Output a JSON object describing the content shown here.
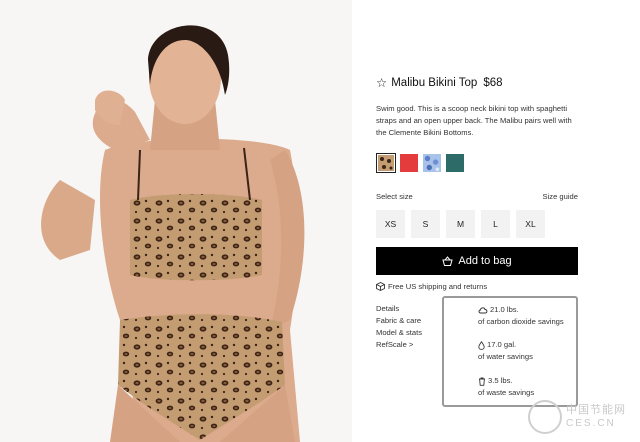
{
  "product": {
    "star_icon": "star-outline-icon",
    "star_glyph": "☆",
    "name": "Malibu Bikini Top",
    "price": "$68",
    "description": "Swim good. This is a scoop neck bikini top with spaghetti straps and an open upper back. The Malibu pairs well with the Clemente Bikini Bottoms."
  },
  "swatches": [
    {
      "name": "leopard",
      "color": "#b99266",
      "selected": true
    },
    {
      "name": "red",
      "color": "#e43c3c",
      "selected": false
    },
    {
      "name": "blue-floral",
      "color": "#7d9fd6",
      "selected": false
    },
    {
      "name": "teal",
      "color": "#2c6b67",
      "selected": false
    }
  ],
  "size": {
    "select_label": "Select size",
    "guide_label": "Size guide",
    "options": [
      "XS",
      "S",
      "M",
      "L",
      "XL"
    ]
  },
  "cart": {
    "add_label": "Add to bag",
    "icon": "bag-icon"
  },
  "shipping": {
    "icon": "box-icon",
    "text": "Free US shipping and returns"
  },
  "details": [
    "Details",
    "Fabric & care",
    "Model & stats",
    "RefScale >"
  ],
  "savings": [
    {
      "icon": "cloud-icon",
      "amount": "21.0 lbs.",
      "label": "of carbon dioxide savings"
    },
    {
      "icon": "water-drop-icon",
      "amount": "17.0 gal.",
      "label": "of water savings"
    },
    {
      "icon": "trash-icon",
      "amount": "3.5 lbs.",
      "label": "of waste savings"
    }
  ],
  "watermark": {
    "line1": "中国节能网",
    "line2": "CES.CN"
  },
  "colors": {
    "button_bg": "#000000",
    "size_bg": "#f2f2f2",
    "box_border": "#9a9a9a"
  }
}
